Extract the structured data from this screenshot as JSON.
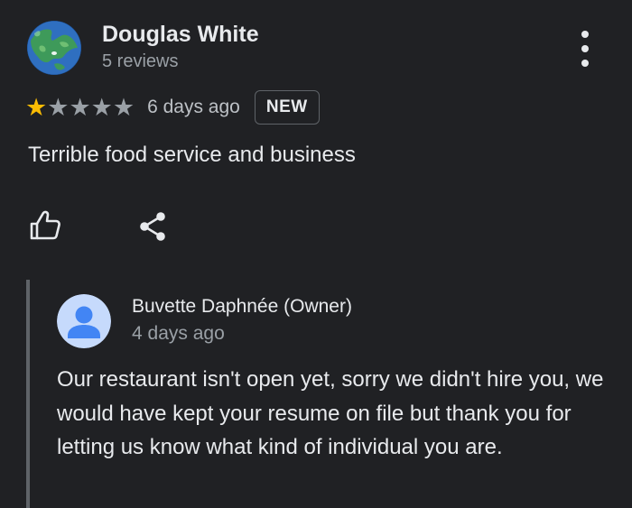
{
  "review": {
    "author_name": "Douglas White",
    "review_count": "5 reviews",
    "rating": 1,
    "rating_max": 5,
    "date": "6 days ago",
    "badge": "NEW",
    "text": "Terrible food service and business"
  },
  "owner_reply": {
    "name": "Buvette Daphnée (Owner)",
    "date": "4 days ago",
    "text": "Our restaurant isn't open yet, sorry we didn't hire you, we would have kept your resume on file but thank you for letting us know what kind of individual you are."
  },
  "icons": {
    "user_avatar": "earth-avatar-icon",
    "owner_avatar": "person-avatar-icon",
    "more": "more-vert-icon",
    "like": "thumbs-up-icon",
    "share": "share-icon"
  },
  "colors": {
    "background": "#202124",
    "text_primary": "#e8eaed",
    "text_secondary": "#9aa0a6",
    "star_filled": "#fbbc04",
    "star_empty": "#9aa0a6",
    "owner_avatar_bg": "#c6dafc",
    "owner_avatar_fg": "#4285f4",
    "reply_bar": "#5f6368"
  }
}
